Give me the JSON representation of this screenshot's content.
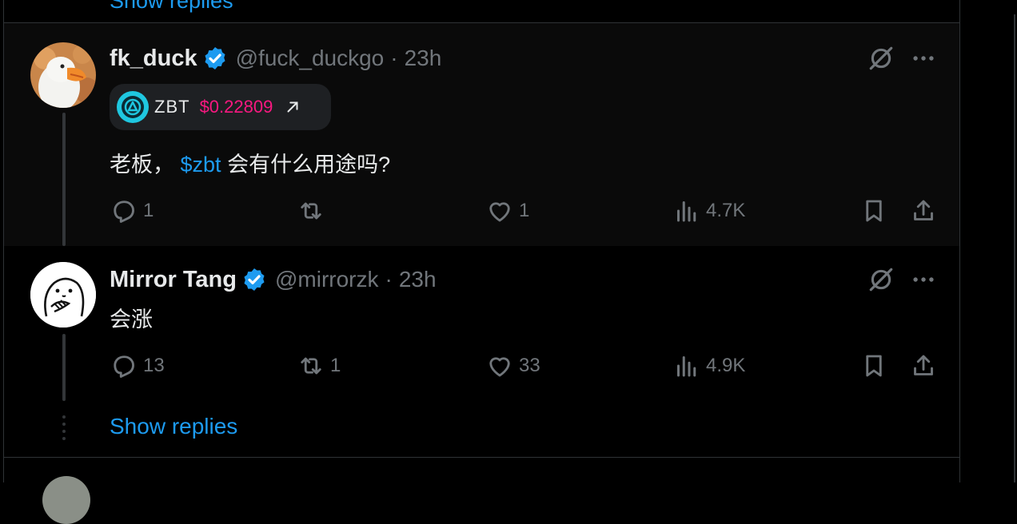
{
  "top": {
    "show_replies_label": "Show replies"
  },
  "tweets": [
    {
      "name": "fk_duck",
      "handle": "@fuck_duckgo",
      "dot": "·",
      "time": "23h",
      "token": {
        "ticker": "ZBT",
        "price": "$0.22809"
      },
      "text_before": "老板，",
      "cashtag": "$zbt",
      "text_after": "会有什么用途吗?",
      "reply_count": "1",
      "retweet_count": "",
      "like_count": "1",
      "view_count": "4.7K"
    },
    {
      "name": "Mirror Tang",
      "handle": "@mirrorzk",
      "dot": "·",
      "time": "23h",
      "text": "会涨",
      "reply_count": "13",
      "retweet_count": "1",
      "like_count": "33",
      "view_count": "4.9K"
    }
  ],
  "show_replies_label": "Show replies",
  "colors": {
    "accent": "#1d9bf0",
    "price": "#f91880",
    "muted": "#71767b",
    "text": "#e7e9ea",
    "border": "#2f3336"
  }
}
